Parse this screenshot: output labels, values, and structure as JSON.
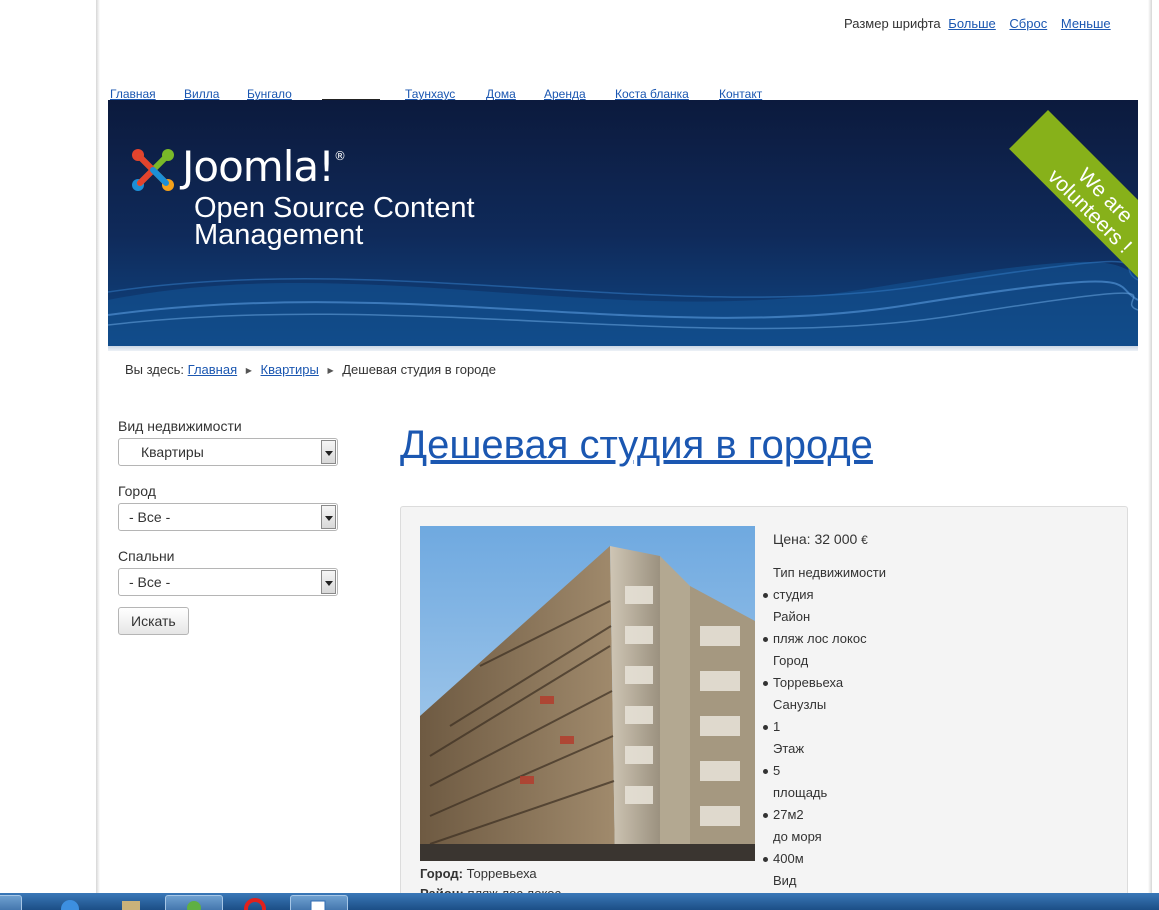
{
  "font_size": {
    "label": "Размер шрифта",
    "larger": "Больше",
    "reset": "Сброс",
    "smaller": "Меньше"
  },
  "nav": [
    {
      "label": "Главная"
    },
    {
      "label": "Вилла"
    },
    {
      "label": "Бунгало"
    },
    {
      "label": "Таунхаус"
    },
    {
      "label": "Дома"
    },
    {
      "label": "Аренда"
    },
    {
      "label": "Коста бланка"
    },
    {
      "label": "Контакт"
    }
  ],
  "header": {
    "logo_text": "Joomla!",
    "tagline": "Open Source Content Management",
    "ribbon": "We are volunteers !",
    "ribbon_color": "#87b11a"
  },
  "breadcrumb": {
    "prefix": "Вы здесь:",
    "items": [
      "Главная",
      "Квартиры"
    ],
    "current": "Дешевая студия в городе"
  },
  "search": {
    "type_label": "Вид недвижимости",
    "type_value": "Квартиры",
    "city_label": "Город",
    "city_value": "- Все -",
    "bedrooms_label": "Спальни",
    "bedrooms_value": "- Все -",
    "button": "Искать"
  },
  "article": {
    "title": "Дешевая студия в городе",
    "price_label": "Цена:",
    "price_value": "32 000",
    "currency": "€",
    "details": [
      {
        "text": "Тип недвижимости",
        "bullet": false
      },
      {
        "text": "студия",
        "bullet": true
      },
      {
        "text": "Район",
        "bullet": false
      },
      {
        "text": "пляж лос локос",
        "bullet": true
      },
      {
        "text": "Город",
        "bullet": false
      },
      {
        "text": "Торревьеха",
        "bullet": true
      },
      {
        "text": "Санузлы",
        "bullet": false
      },
      {
        "text": "1",
        "bullet": true
      },
      {
        "text": "Этаж",
        "bullet": false
      },
      {
        "text": "5",
        "bullet": true
      },
      {
        "text": "площадь",
        "bullet": false
      },
      {
        "text": "27м2",
        "bullet": true
      },
      {
        "text": "до моря",
        "bullet": false
      },
      {
        "text": "400м",
        "bullet": true
      },
      {
        "text": "Вид",
        "bullet": false
      }
    ],
    "caption_city_label": "Город:",
    "caption_city": "Торревьеха",
    "caption_district_label": "Район:",
    "caption_district": "пляж лос локос"
  },
  "colors": {
    "link": "#1b57b1",
    "header_top": "#0c1a3d",
    "header_bottom": "#0f4683",
    "panel_bg": "#f4f4f4"
  }
}
